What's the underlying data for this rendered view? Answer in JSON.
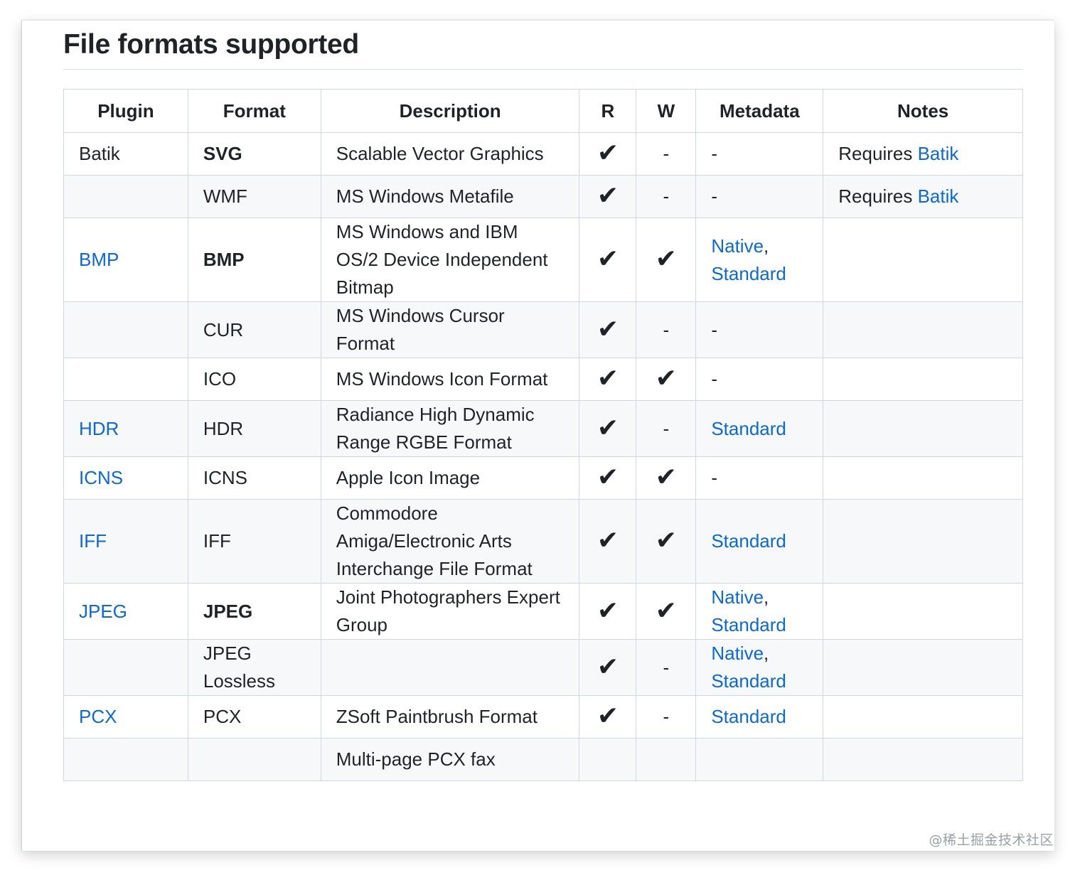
{
  "section": {
    "title": "File formats supported"
  },
  "table": {
    "headers": [
      "Plugin",
      "Format",
      "Description",
      "R",
      "W",
      "Metadata",
      "Notes"
    ],
    "rows": [
      {
        "plugin": "Batik",
        "plugin_link": false,
        "format": "SVG",
        "format_bold": true,
        "description": "Scalable Vector Graphics",
        "r": "✔",
        "w": "-",
        "metadata": "-",
        "metadata_links": [],
        "notes_prefix": "Requires ",
        "notes_link": "Batik"
      },
      {
        "plugin": "",
        "plugin_link": false,
        "format": "WMF",
        "format_bold": false,
        "description": "MS Windows Metafile",
        "r": "✔",
        "w": "-",
        "metadata": "-",
        "metadata_links": [],
        "notes_prefix": "Requires ",
        "notes_link": "Batik"
      },
      {
        "plugin": "BMP",
        "plugin_link": true,
        "format": "BMP",
        "format_bold": true,
        "description": "MS Windows and IBM OS/2 Device Independent Bitmap",
        "r": "✔",
        "w": "✔",
        "metadata": "",
        "metadata_links": [
          "Native",
          "Standard"
        ],
        "notes_prefix": "",
        "notes_link": ""
      },
      {
        "plugin": "",
        "plugin_link": false,
        "format": "CUR",
        "format_bold": false,
        "description": "MS Windows Cursor Format",
        "r": "✔",
        "w": "-",
        "metadata": "-",
        "metadata_links": [],
        "notes_prefix": "",
        "notes_link": ""
      },
      {
        "plugin": "",
        "plugin_link": false,
        "format": "ICO",
        "format_bold": false,
        "description": "MS Windows Icon Format",
        "r": "✔",
        "w": "✔",
        "metadata": "-",
        "metadata_links": [],
        "notes_prefix": "",
        "notes_link": ""
      },
      {
        "plugin": "HDR",
        "plugin_link": true,
        "format": "HDR",
        "format_bold": false,
        "description": "Radiance High Dynamic Range RGBE Format",
        "r": "✔",
        "w": "-",
        "metadata": "",
        "metadata_links": [
          "Standard"
        ],
        "notes_prefix": "",
        "notes_link": ""
      },
      {
        "plugin": "ICNS",
        "plugin_link": true,
        "format": "ICNS",
        "format_bold": false,
        "description": "Apple Icon Image",
        "r": "✔",
        "w": "✔",
        "metadata": "-",
        "metadata_links": [],
        "notes_prefix": "",
        "notes_link": ""
      },
      {
        "plugin": "IFF",
        "plugin_link": true,
        "format": "IFF",
        "format_bold": false,
        "description": "Commodore Amiga/Electronic Arts Interchange File Format",
        "r": "✔",
        "w": "✔",
        "metadata": "",
        "metadata_links": [
          "Standard"
        ],
        "notes_prefix": "",
        "notes_link": ""
      },
      {
        "plugin": "JPEG",
        "plugin_link": true,
        "format": "JPEG",
        "format_bold": true,
        "description": "Joint Photographers Expert Group",
        "r": "✔",
        "w": "✔",
        "metadata": "",
        "metadata_links": [
          "Native",
          "Standard"
        ],
        "notes_prefix": "",
        "notes_link": ""
      },
      {
        "plugin": "",
        "plugin_link": false,
        "format": "JPEG Lossless",
        "format_bold": false,
        "description": "",
        "r": "✔",
        "w": "-",
        "metadata": "",
        "metadata_links": [
          "Native",
          "Standard"
        ],
        "notes_prefix": "",
        "notes_link": ""
      },
      {
        "plugin": "PCX",
        "plugin_link": true,
        "format": "PCX",
        "format_bold": false,
        "description": "ZSoft Paintbrush Format",
        "r": "✔",
        "w": "-",
        "metadata": "",
        "metadata_links": [
          "Standard"
        ],
        "notes_prefix": "",
        "notes_link": ""
      },
      {
        "plugin": "",
        "plugin_link": false,
        "format": "",
        "format_bold": false,
        "description": "Multi-page PCX fax",
        "r": "",
        "w": "",
        "metadata": "",
        "metadata_links": [],
        "notes_prefix": "",
        "notes_link": ""
      }
    ]
  },
  "watermark": "@稀土掘金技术社区"
}
